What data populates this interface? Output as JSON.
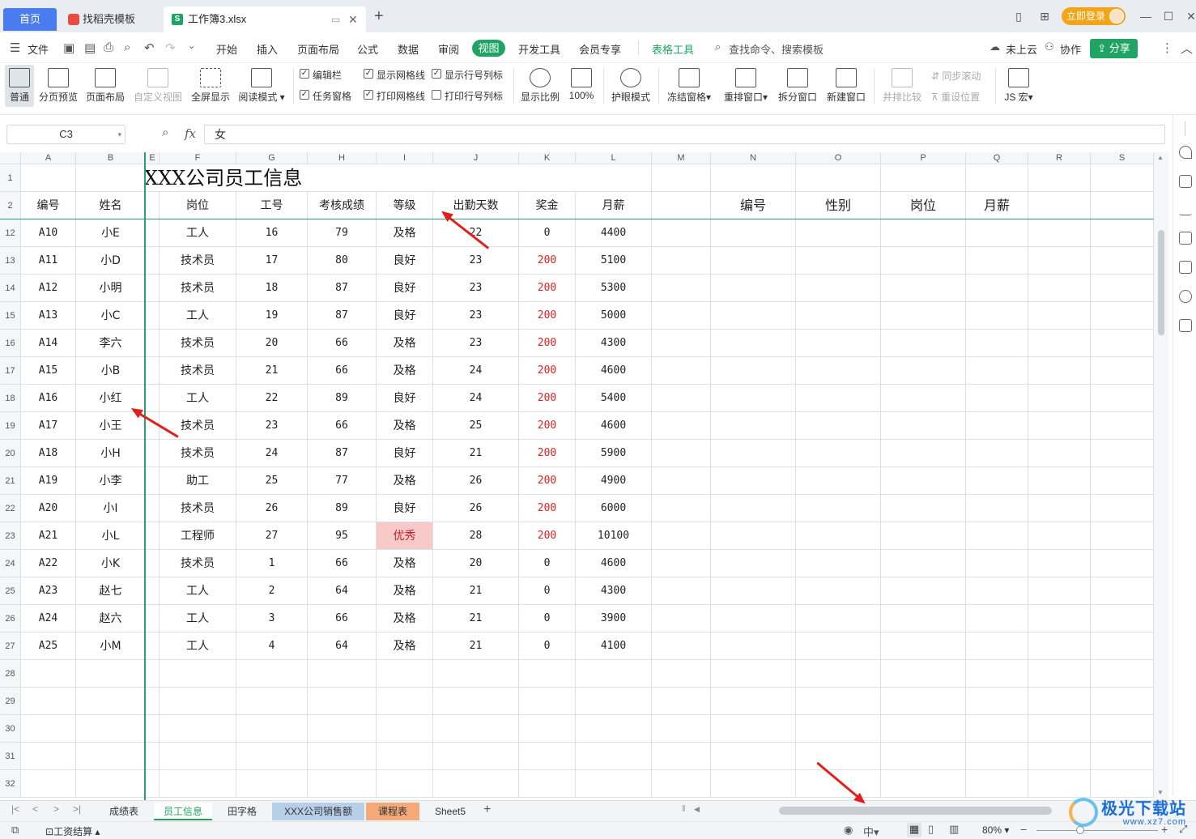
{
  "tabbar": {
    "home": "首页",
    "templates": "找稻壳模板",
    "file": "工作簿3.xlsx",
    "login": "立即登录"
  },
  "menubar": {
    "file": "文件",
    "items": [
      "开始",
      "插入",
      "页面布局",
      "公式",
      "数据",
      "审阅"
    ],
    "active": "视图",
    "items2": [
      "开发工具",
      "会员专享"
    ],
    "table_tools": "表格工具",
    "search": "查找命令、搜索模板",
    "cloud": "未上云",
    "collab": "协作",
    "share": "分享"
  },
  "ribbon": {
    "normal": "普通",
    "page_preview": "分页预览",
    "page_layout": "页面布局",
    "custom_view": "自定义视图",
    "fullscreen": "全屏显示",
    "reading": "阅读模式",
    "edit_bar": "编辑栏",
    "task_pane": "任务窗格",
    "show_grid": "显示网格线",
    "print_grid": "打印网格线",
    "show_header": "显示行号列标",
    "print_header": "打印行号列标",
    "zoom": "显示比例",
    "zoom100": "100%",
    "eye_mode": "护眼模式",
    "freeze": "冻结窗格",
    "rearrange": "重排窗口",
    "split": "拆分窗口",
    "new_window": "新建窗口",
    "side_compare": "并排比较",
    "sync_scroll": "同步滚动",
    "reset_pos": "重设位置",
    "js_macro": "JS 宏"
  },
  "formula": {
    "cell_ref": "C3",
    "fx": "fx",
    "value": "女"
  },
  "grid": {
    "col_headers": [
      "A",
      "B",
      "E",
      "F",
      "G",
      "H",
      "I",
      "J",
      "K",
      "L",
      "M",
      "N",
      "O",
      "P",
      "Q",
      "R",
      "S"
    ],
    "title": "XXX公司员工信息",
    "headers": [
      "编号",
      "姓名",
      "",
      "岗位",
      "工号",
      "考核成绩",
      "等级",
      "出勤天数",
      "奖金",
      "月薪"
    ],
    "right_headers": [
      "编号",
      "性别",
      "岗位",
      "月薪"
    ],
    "rows": [
      {
        "row": "12",
        "cells": [
          "A10",
          "小E",
          "工人",
          "16",
          "79",
          "及格",
          "22",
          "0",
          "4400"
        ]
      },
      {
        "row": "13",
        "cells": [
          "A11",
          "小D",
          "技术员",
          "17",
          "80",
          "良好",
          "23",
          "200",
          "5100"
        ]
      },
      {
        "row": "14",
        "cells": [
          "A12",
          "小明",
          "技术员",
          "18",
          "87",
          "良好",
          "23",
          "200",
          "5300"
        ]
      },
      {
        "row": "15",
        "cells": [
          "A13",
          "小C",
          "工人",
          "19",
          "87",
          "良好",
          "23",
          "200",
          "5000"
        ]
      },
      {
        "row": "16",
        "cells": [
          "A14",
          "李六",
          "技术员",
          "20",
          "66",
          "及格",
          "23",
          "200",
          "4300"
        ]
      },
      {
        "row": "17",
        "cells": [
          "A15",
          "小B",
          "技术员",
          "21",
          "66",
          "及格",
          "24",
          "200",
          "4600"
        ]
      },
      {
        "row": "18",
        "cells": [
          "A16",
          "小红",
          "工人",
          "22",
          "89",
          "良好",
          "24",
          "200",
          "5400"
        ]
      },
      {
        "row": "19",
        "cells": [
          "A17",
          "小王",
          "技术员",
          "23",
          "66",
          "及格",
          "25",
          "200",
          "4600"
        ]
      },
      {
        "row": "20",
        "cells": [
          "A18",
          "小H",
          "技术员",
          "24",
          "87",
          "良好",
          "21",
          "200",
          "5900"
        ]
      },
      {
        "row": "21",
        "cells": [
          "A19",
          "小李",
          "助工",
          "25",
          "77",
          "及格",
          "26",
          "200",
          "4900"
        ]
      },
      {
        "row": "22",
        "cells": [
          "A20",
          "小I",
          "技术员",
          "26",
          "89",
          "良好",
          "26",
          "200",
          "6000"
        ]
      },
      {
        "row": "23",
        "cells": [
          "A21",
          "小L",
          "工程师",
          "27",
          "95",
          "优秀",
          "28",
          "200",
          "10100"
        ]
      },
      {
        "row": "24",
        "cells": [
          "A22",
          "小K",
          "技术员",
          "1",
          "66",
          "及格",
          "20",
          "0",
          "4600"
        ]
      },
      {
        "row": "25",
        "cells": [
          "A23",
          "赵七",
          "工人",
          "2",
          "64",
          "及格",
          "21",
          "0",
          "4300"
        ]
      },
      {
        "row": "26",
        "cells": [
          "A24",
          "赵六",
          "工人",
          "3",
          "66",
          "及格",
          "21",
          "0",
          "3900"
        ]
      },
      {
        "row": "27",
        "cells": [
          "A25",
          "小M",
          "工人",
          "4",
          "64",
          "及格",
          "21",
          "0",
          "4100"
        ]
      }
    ],
    "empty_rows": [
      "28",
      "29",
      "30",
      "31",
      "32"
    ],
    "row1": "1",
    "row2": "2"
  },
  "sheets": {
    "tabs": [
      "成绩表",
      "员工信息",
      "田字格",
      "XXX公司销售额",
      "课程表",
      "Sheet5"
    ],
    "active": "员工信息",
    "tab_colors": {
      "XXX公司销售额": "#b7cfe9",
      "课程表": "#f4a979"
    }
  },
  "status": {
    "workbook": "工资结算",
    "zoom": "80%"
  },
  "watermark": {
    "name": "极光下载站",
    "url": "www.xz7.com"
  },
  "colors": {
    "accent": "#1fa463",
    "home_tab": "#4a7cf0",
    "highlight_fill": "#f8c9c9",
    "bonus_red": "#d22222",
    "annotation_arrow": "#e0211b"
  }
}
